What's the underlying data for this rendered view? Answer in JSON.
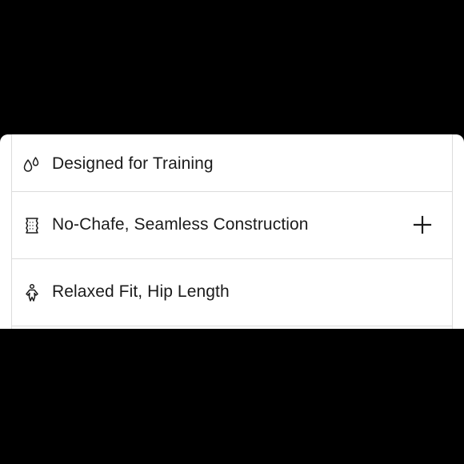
{
  "features": {
    "items": [
      {
        "label": "Designed for Training",
        "icon": "droplets-icon",
        "expandable": false
      },
      {
        "label": "No-Chafe, Seamless Construction",
        "icon": "fabric-swatch-icon",
        "expandable": true
      },
      {
        "label": "Relaxed Fit, Hip Length",
        "icon": "person-fit-icon",
        "expandable": false
      }
    ],
    "expand_icon": "plus-icon"
  },
  "colors": {
    "text": "#1b1b1b",
    "divider": "#dcdcdc",
    "background": "#ffffff",
    "letterbox": "#000000"
  }
}
